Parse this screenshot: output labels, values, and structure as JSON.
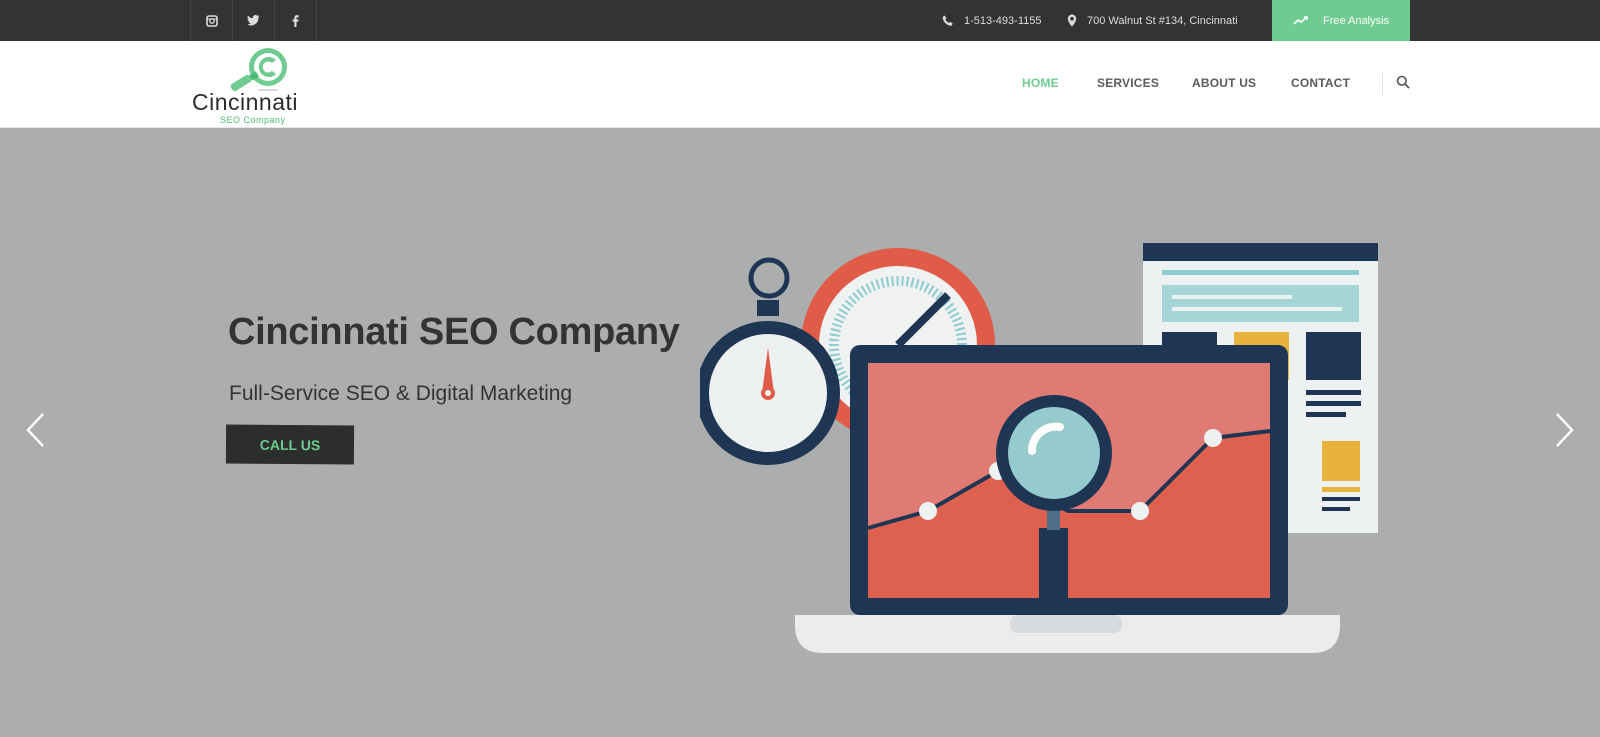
{
  "topbar": {
    "social": [
      {
        "name": "instagram-icon"
      },
      {
        "name": "twitter-icon"
      },
      {
        "name": "facebook-icon"
      }
    ],
    "phone": "1-513-493-1155",
    "address": "700 Walnut St #134, Cincinnati",
    "cta_label": "Free Analysis",
    "colors": {
      "bar": "#333333",
      "accent": "#6fcb8f"
    }
  },
  "header": {
    "logo_name": "Cincinnati",
    "logo_sub": "SEO Company",
    "nav": [
      {
        "label": "HOME",
        "active": true
      },
      {
        "label": "SERVICES",
        "active": false
      },
      {
        "label": "ABOUT US",
        "active": false
      },
      {
        "label": "CONTACT",
        "active": false
      }
    ]
  },
  "hero": {
    "title": "Cincinnati SEO Company",
    "subtitle": "Full-Service SEO & Digital Marketing",
    "cta_label": "CALL US",
    "background": "#acadad"
  }
}
